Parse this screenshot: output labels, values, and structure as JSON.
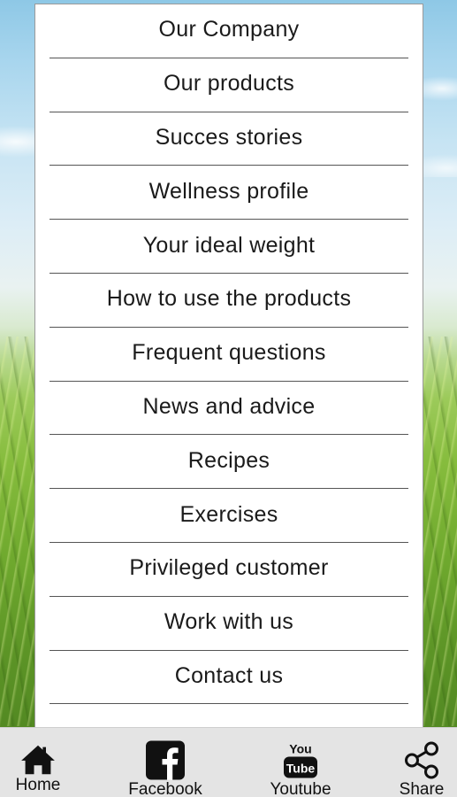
{
  "menu": {
    "items": [
      {
        "label": "Our Company"
      },
      {
        "label": "Our products"
      },
      {
        "label": "Succes stories"
      },
      {
        "label": "Wellness profile"
      },
      {
        "label": "Your ideal weight"
      },
      {
        "label": "How to use the products"
      },
      {
        "label": "Frequent questions"
      },
      {
        "label": "News and advice"
      },
      {
        "label": "Recipes"
      },
      {
        "label": "Exercises"
      },
      {
        "label": "Privileged customer"
      },
      {
        "label": "Work with us"
      },
      {
        "label": "Contact us"
      }
    ]
  },
  "bottom_nav": {
    "home": {
      "label": "Home",
      "icon": "home-icon"
    },
    "facebook": {
      "label": "Facebook",
      "icon": "facebook-icon"
    },
    "youtube": {
      "label": "Youtube",
      "icon": "youtube-icon",
      "icon_text_top": "You",
      "icon_text_bottom": "Tube"
    },
    "share": {
      "label": "Share",
      "icon": "share-icon"
    }
  },
  "colors": {
    "panel_background": "#ffffff",
    "divider": "#555555",
    "nav_background": "#e4e4e4",
    "icon": "#111111"
  }
}
